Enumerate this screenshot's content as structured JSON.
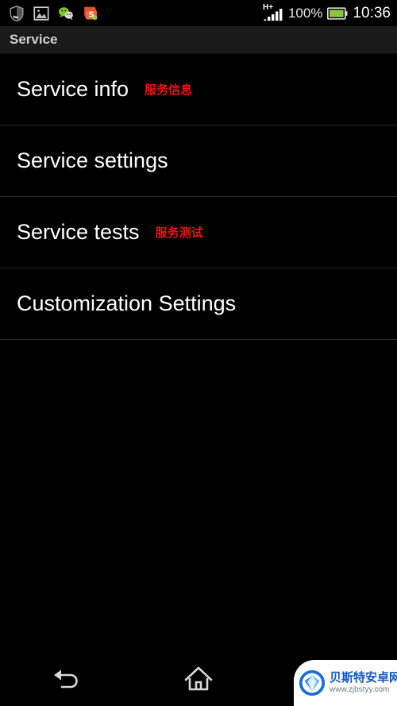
{
  "status_bar": {
    "notification_icons": [
      {
        "name": "security-shield-icon",
        "label": "Security"
      },
      {
        "name": "gallery-photo-icon",
        "label": "Gallery"
      },
      {
        "name": "wechat-icon",
        "label": "WeChat"
      },
      {
        "name": "sogou-input-icon",
        "label": "Sogou"
      }
    ],
    "network_type": "H+",
    "signal_bars": 4,
    "battery_percent": "100%",
    "battery_icon": "battery-full-icon",
    "time": "10:36"
  },
  "action_bar": {
    "title": "Service"
  },
  "list": {
    "items": [
      {
        "title": "Service info",
        "annotation": "服务信息"
      },
      {
        "title": "Service settings",
        "annotation": ""
      },
      {
        "title": "Service tests",
        "annotation": "服务测试"
      },
      {
        "title": "Customization Settings",
        "annotation": ""
      }
    ]
  },
  "nav_bar": {
    "back": "back-icon",
    "home": "home-icon",
    "recents": "recents-icon"
  },
  "watermark": {
    "title": "贝斯特安卓网",
    "url": "www.zjbstyy.com",
    "logo": "shell-diamond-logo"
  },
  "colors": {
    "background": "#000000",
    "action_bar": "#1a1a1a",
    "divider": "#2a2a2a",
    "primary_text": "#ffffff",
    "title_text": "#d0d0d0",
    "annotation_red": "#ee1414",
    "battery_green": "#8cc63f",
    "watermark_blue": "#1256c4"
  }
}
